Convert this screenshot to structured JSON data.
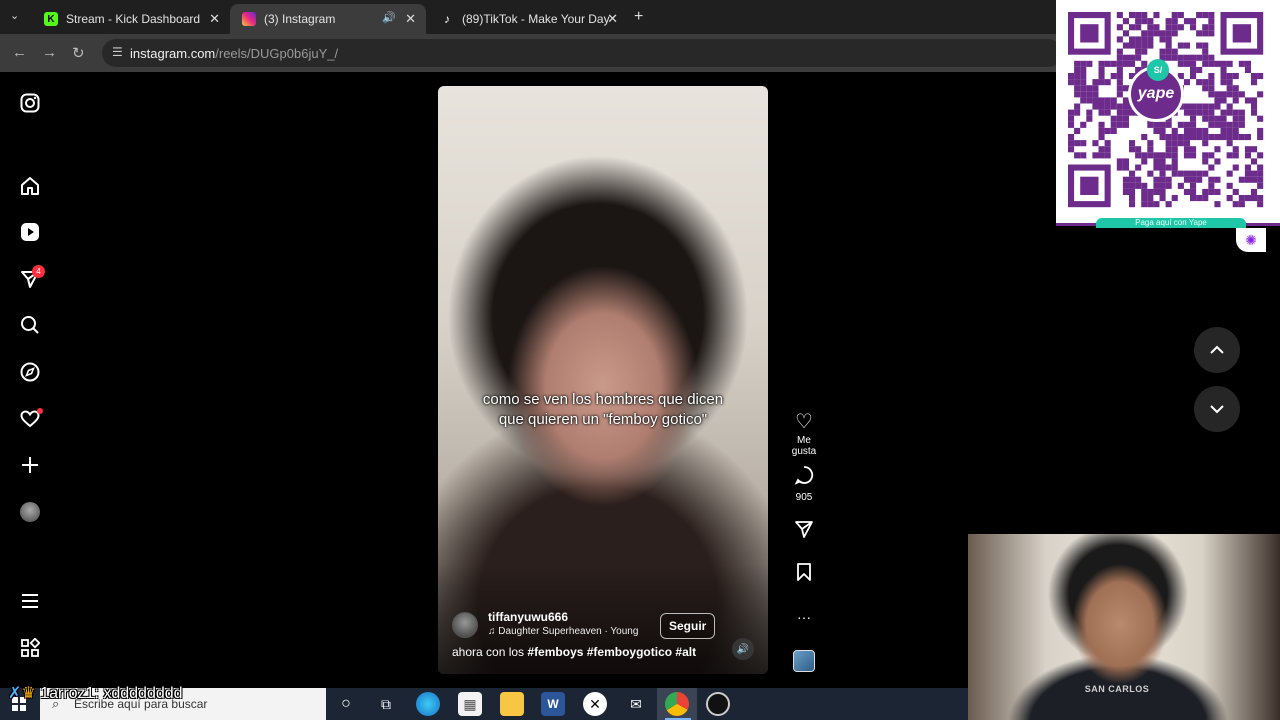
{
  "browser": {
    "tabs": [
      {
        "title": "Stream - Kick Dashboard",
        "favicon": "kick-icon",
        "color": "#53fc18"
      },
      {
        "title": "(3) Instagram",
        "favicon": "instagram-icon",
        "color": "#e1306c",
        "active": true
      },
      {
        "title": "(89)TikTok - Make Your Day",
        "favicon": "tiktok-icon",
        "color": "#ffffff"
      }
    ],
    "url_host": "instagram.com",
    "url_path": "/reels/DUGp0b6juY_/"
  },
  "sidebar": {
    "items": [
      "instagram-logo",
      "home",
      "reels",
      "messages",
      "search",
      "explore",
      "notifications",
      "create",
      "profile",
      "more",
      "meta-apps"
    ],
    "messages_badge": "4"
  },
  "reel": {
    "overlay_text": "como se ven los hombres que dicen que quieren un \"femboy gotico\"",
    "author": "tiffanyuwu666",
    "music": "Daughter  Superheaven · Young",
    "follow_label": "Seguir",
    "caption_prefix": "ahora con los",
    "hashtags": "#femboys #femboygotico #alt"
  },
  "actions": {
    "like_label": "Me gusta",
    "comment_count": "905",
    "more": "···"
  },
  "overlay": {
    "qr_brand": "yape",
    "qr_currency": "S/",
    "qr_strip": "Paga aquí con Yape",
    "chat_text": "1arroz1: xdddddddd",
    "webcam_shirt": "SAN CARLOS"
  },
  "taskbar": {
    "search_placeholder": "Escribe aquí para buscar"
  },
  "colors": {
    "accent_red": "#ff3040",
    "yape_purple": "#6d2c8c",
    "yape_green": "#1dc7a8"
  }
}
